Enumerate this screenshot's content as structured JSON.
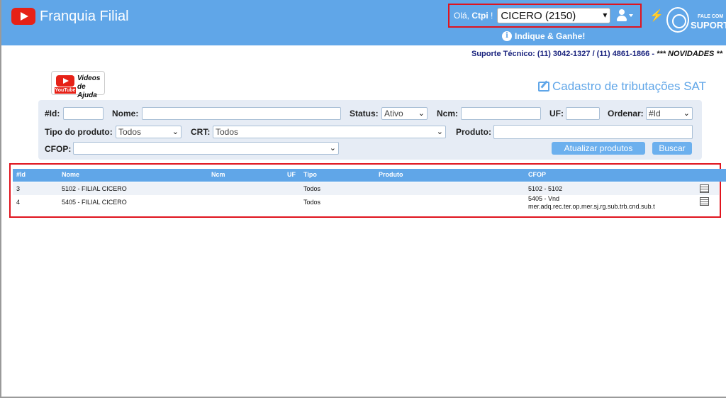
{
  "header": {
    "app_title": "Franquia Filial",
    "greeting_prefix": "Olá, ",
    "greeting_user": "Ctpi",
    "greeting_suffix": " !",
    "company_selected": "CICERO (2150)",
    "indique": "Indique & Ganhe!",
    "fale_com": "FALE COM",
    "suporte": "SUPORT"
  },
  "support_line": {
    "text": "Suporte Técnico: (11) 3042-1327 / (11) 4861-1866 - ",
    "news": "*** NOVIDADES **"
  },
  "video_badge": {
    "yt": "YouTube",
    "line1": "Videos",
    "line2": "de Ajuda"
  },
  "page_title": "Cadastro de tributações SAT",
  "filters": {
    "id_label": "#Id:",
    "nome_label": "Nome:",
    "status_label": "Status:",
    "status_value": "Ativo",
    "ncm_label": "Ncm:",
    "uf_label": "UF:",
    "ordenar_label": "Ordenar:",
    "ordenar_value": "#Id",
    "tipo_label": "Tipo do produto:",
    "tipo_value": "Todos",
    "crt_label": "CRT:",
    "crt_value": "Todos",
    "produto_label": "Produto:",
    "cfop_label": "CFOP:",
    "cfop_value": "",
    "btn_atualizar": "Atualizar produtos",
    "btn_buscar": "Buscar"
  },
  "table": {
    "columns": {
      "id": "#Id",
      "nome": "Nome",
      "ncm": "Ncm",
      "uf": "UF",
      "tipo": "Tipo",
      "produto": "Produto",
      "cfop": "CFOP"
    },
    "rows": [
      {
        "id": "3",
        "nome": "5102 - FILIAL CICERO",
        "tipo": "Todos",
        "cfop_line1": "5102 - 5102",
        "cfop_line2": ""
      },
      {
        "id": "4",
        "nome": "5405 - FILIAL CICERO",
        "tipo": "Todos",
        "cfop_line1": "5405 - Vnd",
        "cfop_line2": "mer.adq.rec.ter.op.mer.sj.rg.sub.trb.cnd.sub.t"
      }
    ]
  },
  "icons": {
    "logo": "youtube-play-icon",
    "user": "user-icon",
    "bolt": "bolt-icon",
    "support": "headset-icon",
    "info": "info-icon",
    "edit": "edit-icon",
    "row_action": "document-list-icon"
  },
  "colors": {
    "header_bg": "#60a6e8",
    "highlight_border": "#e0141e",
    "title_blue": "#60a6e8",
    "support_text": "#1a237e"
  }
}
